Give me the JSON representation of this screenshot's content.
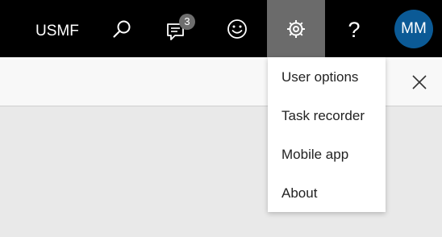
{
  "topbar": {
    "company": "USMF",
    "search_icon": "search-icon",
    "messages": {
      "icon": "message-icon",
      "badge": "3"
    },
    "feedback_icon": "smiley-icon",
    "settings_icon": "gear-icon",
    "help": {
      "icon": "question-icon",
      "glyph": "?"
    },
    "avatar_initials": "MM"
  },
  "subbar": {
    "close_icon": "close-icon"
  },
  "settings_menu": {
    "items": [
      {
        "label": "User options"
      },
      {
        "label": "Task recorder"
      },
      {
        "label": "Mobile app"
      },
      {
        "label": "About"
      }
    ]
  },
  "colors": {
    "topbar": "#000000",
    "settings_active": "#6b6b6b",
    "avatar": "#0b5a96",
    "background": "#e9e9e9"
  }
}
